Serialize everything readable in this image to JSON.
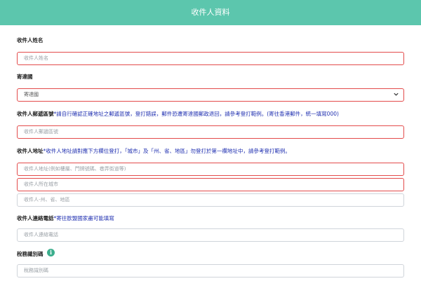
{
  "header": {
    "title": "收件人資料"
  },
  "form": {
    "name": {
      "label": "收件人姓名",
      "placeholder": "收件人姓名"
    },
    "country": {
      "label": "寄達國",
      "value": "寄達國"
    },
    "postal": {
      "label": "收件人郵遞區號",
      "note": "*請自行確認正確地址之郵遞區號，登打錯誤，郵件恐遭寄達國郵政退回，請參考登打範例。(寄往香港郵件，統一填寫000)",
      "placeholder": "收件人郵遞區號"
    },
    "address": {
      "label": "收件人地址",
      "note": "*收件人地址請對應下方欄位登打，「城市」及「州、省、地區」勿登打於第一欄地址中，請參考登打範例。",
      "line1_placeholder": "收件人地址(例如樓層、門牌號碼、巷弄街道等)",
      "city_placeholder": "收件人所在城市",
      "state_placeholder": "收件人-州、省、地區"
    },
    "phone": {
      "label": "收件人連絡電話",
      "note": "*寄往歐盟國家盡可能填寫",
      "placeholder": "收件人連絡電話"
    },
    "tax_id": {
      "label": "稅務識別碼",
      "placeholder": "稅務識別碼",
      "info_icon": "i"
    }
  },
  "colors": {
    "header_bg": "#5cc6ad",
    "error_border": "#e34b4b",
    "note_text": "#1f2fb0",
    "info_icon": "#3cae8d"
  }
}
